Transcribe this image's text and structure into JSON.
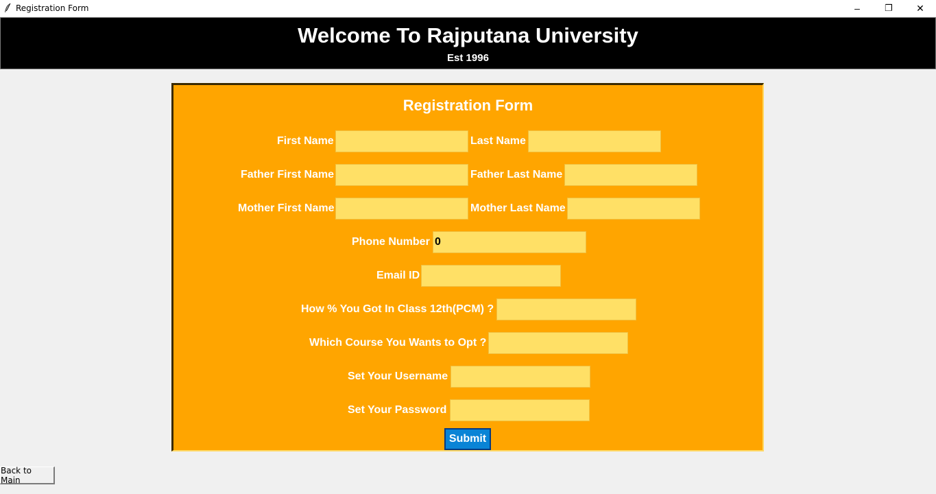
{
  "window": {
    "title": "Registration Form",
    "controls": {
      "minimize": "–",
      "restore": "❐",
      "close": "✕"
    },
    "icon": "feather-icon"
  },
  "header": {
    "title": "Welcome To Rajputana University",
    "subtitle": "Est 1996"
  },
  "form": {
    "title": "Registration Form",
    "first_name": {
      "label": "First Name",
      "value": ""
    },
    "last_name": {
      "label": "Last Name",
      "value": ""
    },
    "father_first_name": {
      "label": "Father First Name",
      "value": ""
    },
    "father_last_name": {
      "label": "Father Last Name",
      "value": ""
    },
    "mother_first_name": {
      "label": "Mother First Name",
      "value": ""
    },
    "mother_last_name": {
      "label": "Mother Last Name",
      "value": ""
    },
    "phone_number": {
      "label": "Phone Number",
      "value": "0"
    },
    "email_id": {
      "label": "Email ID",
      "value": ""
    },
    "percentage_12th": {
      "label": "How % You Got In Class 12th(PCM) ?",
      "value": ""
    },
    "course": {
      "label": "Which Course You Wants to Opt ?",
      "value": ""
    },
    "username": {
      "label": "Set Your Username",
      "value": ""
    },
    "password": {
      "label": "Set Your Password",
      "value": ""
    },
    "submit_label": "Submit"
  },
  "back_button": {
    "label": "Back to Main"
  },
  "colors": {
    "header_bg": "#000000",
    "form_bg": "#ffa500",
    "field_bg": "#ffe066",
    "submit_bg": "#0a84d6"
  }
}
